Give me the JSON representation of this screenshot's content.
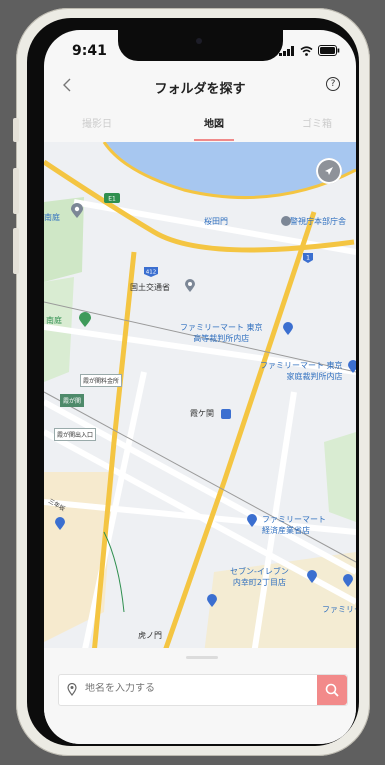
{
  "status_bar": {
    "time": "9:41"
  },
  "header": {
    "title": "フォルダを探す",
    "help_symbol": "?"
  },
  "tabs": [
    {
      "label": "撮影日",
      "active": false
    },
    {
      "label": "地図",
      "active": true
    },
    {
      "label": "ゴミ箱",
      "active": false
    }
  ],
  "map": {
    "labels": {
      "sakuradamon": "桜田門",
      "keishicho": "警視庁本部庁舎",
      "mlit": "国土交通省",
      "east_garden": "南庭",
      "fm_tokyo_koto": "ファミリーマート 東京\n高等裁判所内店",
      "fm_tokyo_katei": "ファミリーマート 東京\n家庭裁判所内店",
      "kasumigaseki": "霞ケ関",
      "fm_keizai": "ファミリーマート\n経済産業省店",
      "seven_uchisaiwai": "セブン-イレブン\n内幸町2丁目店",
      "fm_partial": "ファミリー",
      "toranomon": "虎ノ門",
      "sannenzaka": "三年坂",
      "left_top": "南庭",
      "route_412": "412",
      "route_1": "1",
      "route_e1": "E1"
    },
    "tags": {
      "tag1": "霞が関料金所",
      "tag2": "霞が関",
      "tag3": "霞が関出入口"
    }
  },
  "search": {
    "placeholder": "地名を入力する"
  },
  "colors": {
    "accent": "#f28a8a",
    "water": "#a7c7f0",
    "road": "#f4c542",
    "park": "#cfe7c6"
  }
}
